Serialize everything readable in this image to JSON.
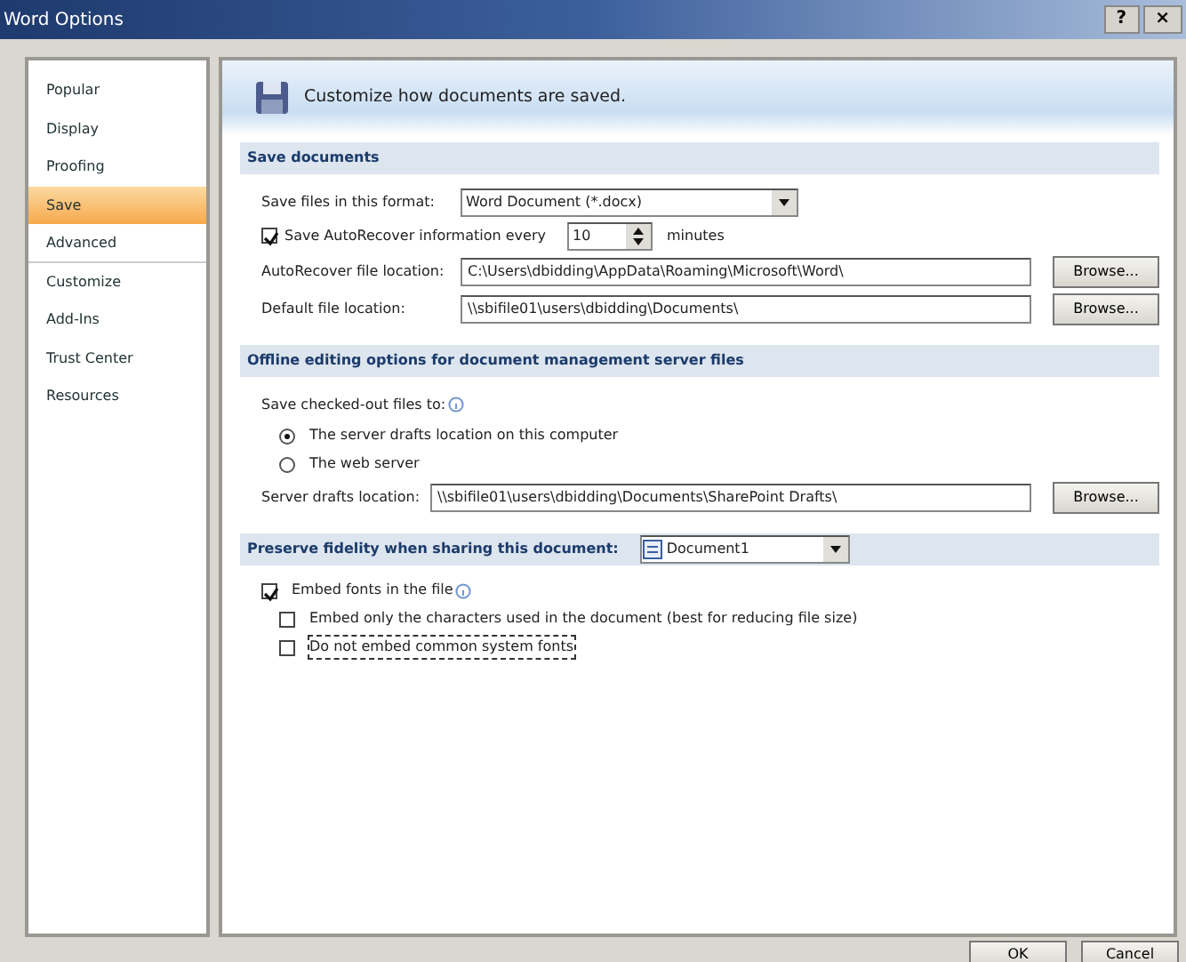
{
  "window": {
    "title": "Word Options",
    "buttons": [
      "?",
      "×"
    ]
  },
  "sidebar": {
    "items": [
      {
        "label": "Popular",
        "selected": false,
        "group_end": false
      },
      {
        "label": "Display",
        "selected": false,
        "group_end": false
      },
      {
        "label": "Proofing",
        "selected": false,
        "group_end": false
      },
      {
        "label": "Save",
        "selected": true,
        "group_end": false
      },
      {
        "label": "Advanced",
        "selected": false,
        "group_end": true
      },
      {
        "label": "Customize",
        "selected": false,
        "group_end": false
      },
      {
        "label": "Add-Ins",
        "selected": false,
        "group_end": false
      },
      {
        "label": "Trust Center",
        "selected": false,
        "group_end": false
      },
      {
        "label": "Resources",
        "selected": false,
        "group_end": false
      }
    ]
  },
  "header": "Customize how documents are saved.",
  "sections": [
    {
      "title": "Save documents",
      "items": [
        {
          "kind": "select",
          "label": "Save files in this format:",
          "value": "Word Document (*.docx)"
        },
        {
          "kind": "spin",
          "label": "Save AutoRecover information every",
          "checked": true,
          "value": "10",
          "unit": "minutes"
        },
        {
          "kind": "path",
          "label": "AutoRecover file location:",
          "value": "C:\\Users\\dbidding\\AppData\\Roaming\\Microsoft\\Word\\",
          "button": "Browse..."
        },
        {
          "kind": "path",
          "label": "Default file location:",
          "value": "\\\\sbifile01\\users\\dbidding\\Documents\\",
          "button": "Browse..."
        }
      ]
    },
    {
      "title": "Offline editing options for document management server files",
      "items": [
        {
          "kind": "text",
          "label": "Save checked-out files to:",
          "info": true
        },
        {
          "kind": "radio",
          "label": "The server drafts location on this computer",
          "selected": true
        },
        {
          "kind": "radio",
          "label": "The web server",
          "selected": false
        },
        {
          "kind": "path",
          "label": "Server drafts location:",
          "value": "\\\\sbifile01\\users\\dbidding\\Documents\\SharePoint Drafts\\",
          "button": "Browse...",
          "narrow": true
        }
      ]
    },
    {
      "title": "Preserve fidelity when sharing this document:",
      "document": "Document1",
      "items": [
        {
          "kind": "check",
          "label": "Embed fonts in the file",
          "checked": true,
          "info": true,
          "indent": false,
          "focused": false
        },
        {
          "kind": "check",
          "label": "Embed only the characters used in the document (best for reducing file size)",
          "checked": false,
          "info": false,
          "indent": true,
          "focused": false
        },
        {
          "kind": "check",
          "label": "Do not embed common system fonts",
          "checked": false,
          "info": false,
          "indent": true,
          "focused": true
        }
      ]
    }
  ],
  "footer": {
    "buttons": [
      "OK",
      "Cancel"
    ]
  }
}
